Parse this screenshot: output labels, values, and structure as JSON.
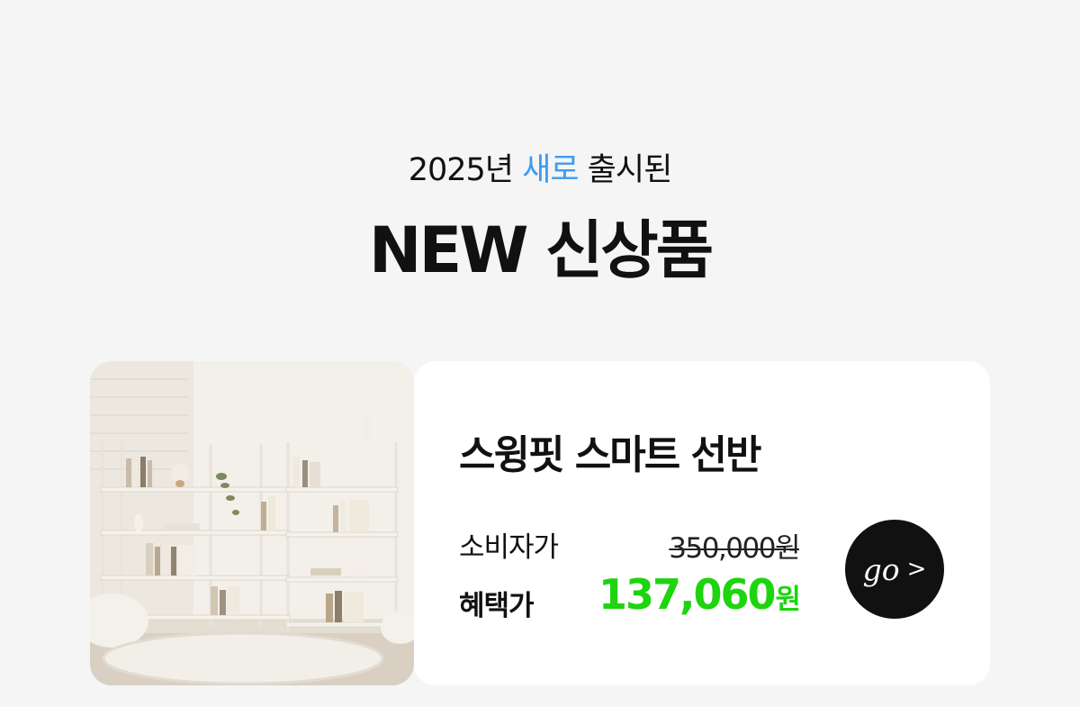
{
  "header": {
    "subtitle_prefix": "2025년",
    "subtitle_accent": "새로",
    "subtitle_suffix": "출시된",
    "title": "NEW 신상품"
  },
  "product": {
    "name": "스윙핏 스마트 선반",
    "retail_label": "소비자가",
    "retail_price": "350,000원",
    "sale_label": "혜택가",
    "sale_price_number": "137,060",
    "sale_price_unit": "원",
    "go_label": "go",
    "go_arrow": ">"
  },
  "colors": {
    "accent": "#3d9bf0",
    "sale": "#1ed40f",
    "button": "#111111",
    "background": "#f5f5f5"
  },
  "icons": {
    "go_arrow": "chevron-right-icon"
  }
}
